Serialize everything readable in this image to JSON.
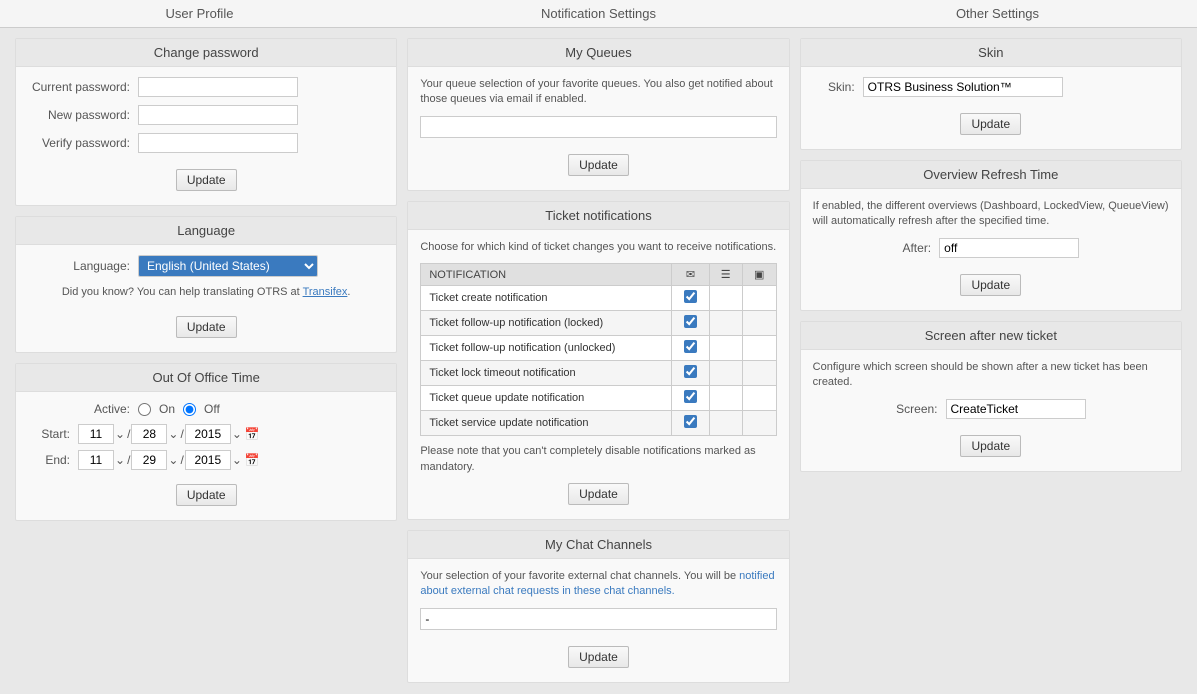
{
  "columns": {
    "user_profile": "User Profile",
    "notification_settings": "Notification Settings",
    "other_settings": "Other Settings"
  },
  "user_profile": {
    "change_password": {
      "title": "Change password",
      "current_password_label": "Current password:",
      "new_password_label": "New password:",
      "verify_password_label": "Verify password:",
      "update_button": "Update"
    },
    "language": {
      "title": "Language",
      "language_label": "Language:",
      "language_value": "English (United States)",
      "info_text": "Did you know? You can help translating OTRS at Transifex.",
      "transifex_link": "Transifex",
      "update_button": "Update"
    },
    "out_of_office": {
      "title": "Out Of Office Time",
      "active_label": "Active:",
      "on_label": "On",
      "off_label": "Off",
      "start_label": "Start:",
      "start_month": "11",
      "start_day": "28",
      "start_year": "2015",
      "end_label": "End:",
      "end_month": "11",
      "end_day": "29",
      "end_year": "2015",
      "update_button": "Update"
    }
  },
  "notification_settings": {
    "my_queues": {
      "title": "My Queues",
      "info_text": "Your queue selection of your favorite queues. You also get notified about those queues via email if enabled.",
      "update_button": "Update"
    },
    "ticket_notifications": {
      "title": "Ticket notifications",
      "info_text": "Choose for which kind of ticket changes you want to receive notifications.",
      "col_notification": "NOTIFICATION",
      "col_email_icon": "✉",
      "col_list_icon": "☰",
      "col_phone_icon": "▣",
      "rows": [
        {
          "label": "Ticket create notification",
          "email": true,
          "list": false,
          "phone": false
        },
        {
          "label": "Ticket follow-up notification (locked)",
          "email": true,
          "list": false,
          "phone": false
        },
        {
          "label": "Ticket follow-up notification (unlocked)",
          "email": true,
          "list": false,
          "phone": false
        },
        {
          "label": "Ticket lock timeout notification",
          "email": true,
          "list": false,
          "phone": false
        },
        {
          "label": "Ticket queue update notification",
          "email": true,
          "list": false,
          "phone": false
        },
        {
          "label": "Ticket service update notification",
          "email": true,
          "list": false,
          "phone": false
        }
      ],
      "note_text": "Please note that you can't completely disable notifications marked as mandatory.",
      "update_button": "Update"
    },
    "my_chat_channels": {
      "title": "My Chat Channels",
      "info_text": "Your selection of your favorite external chat channels. You will be notified about external chat requests in these chat channels.",
      "chat_placeholder": "-",
      "update_button": "Update"
    }
  },
  "other_settings": {
    "skin": {
      "title": "Skin",
      "skin_label": "Skin:",
      "skin_value": "OTRS Business Solution™",
      "update_button": "Update"
    },
    "overview_refresh": {
      "title": "Overview Refresh Time",
      "info_text": "If enabled, the different overviews (Dashboard, LockedView, QueueView) will automatically refresh after the specified time.",
      "after_label": "After:",
      "after_value": "off",
      "update_button": "Update"
    },
    "screen_after_ticket": {
      "title": "Screen after new ticket",
      "info_text": "Configure which screen should be shown after a new ticket has been created.",
      "screen_label": "Screen:",
      "screen_value": "CreateTicket",
      "update_button": "Update"
    }
  }
}
